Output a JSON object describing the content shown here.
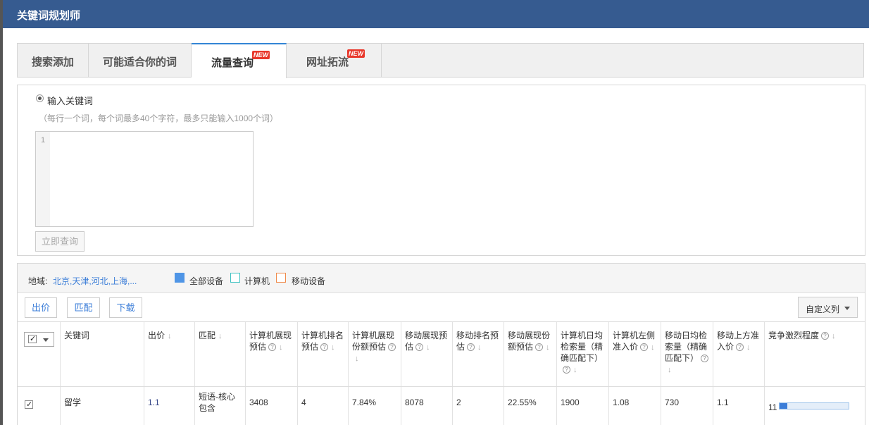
{
  "app": {
    "title": "关键词规划师"
  },
  "tabs": [
    {
      "label": "搜索添加",
      "new": false
    },
    {
      "label": "可能适合你的词",
      "new": false
    },
    {
      "label": "流量查询",
      "new": true,
      "active": true
    },
    {
      "label": "网址拓流",
      "new": true
    }
  ],
  "new_badge": "NEW",
  "input": {
    "radio_label": "输入关键词",
    "hint": "（每行一个词，每个词最多40个字符，最多只能输入1000个词）",
    "line_number": "1",
    "query_button": "立即查询"
  },
  "filters": {
    "region_label": "地域:",
    "region_value": "北京,天津,河北,上海,...",
    "legend": [
      {
        "label": "全部设备",
        "color": "#4f95e6",
        "filled": true
      },
      {
        "label": "计算机",
        "color": "#3fc2c2",
        "filled": false
      },
      {
        "label": "移动设备",
        "color": "#f08a4b",
        "filled": false
      }
    ]
  },
  "toolbar": {
    "bid_label": "出价",
    "match_label": "匹配",
    "download_label": "下载",
    "custom_label": "自定义列"
  },
  "table": {
    "headers": [
      {
        "lines": [
          "关键词"
        ]
      },
      {
        "lines": [
          "出价"
        ],
        "sort": true
      },
      {
        "lines": [
          "匹配"
        ],
        "sort": true
      },
      {
        "lines": [
          "计算机展现",
          "预估"
        ],
        "help": true,
        "sort": true
      },
      {
        "lines": [
          "计算机排名",
          "预估"
        ],
        "help": true,
        "sort": true
      },
      {
        "lines": [
          "计算机展现",
          "份额预估"
        ],
        "help": true,
        "sort": true
      },
      {
        "lines": [
          "移动展现预",
          "估"
        ],
        "help": true,
        "sort": true
      },
      {
        "lines": [
          "移动排名预",
          "估"
        ],
        "help": true,
        "sort": true
      },
      {
        "lines": [
          "移动展现份",
          "额预估"
        ],
        "help": true,
        "sort": true
      },
      {
        "lines": [
          "计算机日均",
          "检索量（精",
          "确匹配下）"
        ],
        "help": true,
        "sort": true
      },
      {
        "lines": [
          "计算机左侧",
          "准入价"
        ],
        "help": true,
        "sort": true
      },
      {
        "lines": [
          "移动日均检",
          "索量（精确",
          "匹配下）"
        ],
        "help": true,
        "sort": true
      },
      {
        "lines": [
          "移动上方准",
          "入价"
        ],
        "help": true,
        "sort": true
      },
      {
        "lines": [
          "竞争激烈程度"
        ],
        "help": true,
        "sort": true
      }
    ],
    "rows": [
      {
        "keyword": "留学",
        "bid": "1.1",
        "match": "短语-核心包含",
        "pc_impressions": "3408",
        "pc_rank": "4",
        "pc_share": "7.84%",
        "mobile_impressions": "8078",
        "mobile_rank": "2",
        "mobile_share": "22.55%",
        "pc_daily_search": "1900",
        "pc_left_price": "1.08",
        "mobile_daily_search": "730",
        "mobile_top_price": "1.1",
        "competition": "11",
        "competition_level": 0.11
      }
    ]
  }
}
